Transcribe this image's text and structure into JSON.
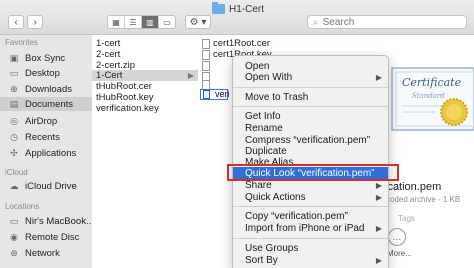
{
  "window": {
    "title": "H1-Cert"
  },
  "toolbar": {
    "back": "‹",
    "forward": "›",
    "view_modes": [
      "icons",
      "list",
      "columns",
      "gallery"
    ],
    "action_label": "⚙ ▾",
    "search_placeholder": "Search"
  },
  "sidebar": {
    "favorites_header": "Favorites",
    "favorites": [
      {
        "label": "Box Sync",
        "icon": "box-icon"
      },
      {
        "label": "Desktop",
        "icon": "desktop-icon"
      },
      {
        "label": "Downloads",
        "icon": "downloads-icon"
      },
      {
        "label": "Documents",
        "icon": "documents-icon"
      },
      {
        "label": "AirDrop",
        "icon": "airdrop-icon"
      },
      {
        "label": "Recents",
        "icon": "recents-icon"
      },
      {
        "label": "Applications",
        "icon": "applications-icon"
      }
    ],
    "icloud_header": "iCloud",
    "icloud": [
      {
        "label": "iCloud Drive",
        "icon": "cloud-icon"
      }
    ],
    "locations_header": "Locations",
    "locations": [
      {
        "label": "Nir's MacBook...",
        "icon": "laptop-icon"
      },
      {
        "label": "Remote Disc",
        "icon": "disc-icon"
      },
      {
        "label": "Network",
        "icon": "network-icon"
      }
    ]
  },
  "column1": {
    "items": [
      "1-cert",
      "2-cert",
      "2-cert.zip",
      "1-Cert",
      "tHubRoot.cer",
      "tHubRoot.key",
      "verification.key"
    ]
  },
  "column2": {
    "items": [
      "cert1Root.cer",
      "cert1Root.key",
      "",
      "",
      "",
      "verific"
    ]
  },
  "rename_field": {
    "value": "veri"
  },
  "context_menu": {
    "items": [
      {
        "label": "Open",
        "submenu": false
      },
      {
        "label": "Open With",
        "submenu": true
      },
      {
        "label": "Move to Trash",
        "submenu": false
      },
      {
        "label": "Get Info",
        "submenu": false
      },
      {
        "label": "Rename",
        "submenu": false
      },
      {
        "label": "Compress “verification.pem”",
        "submenu": false
      },
      {
        "label": "Duplicate",
        "submenu": false
      },
      {
        "label": "Make Alias",
        "submenu": false
      },
      {
        "label": "Quick Look “verification.pem”",
        "submenu": false
      },
      {
        "label": "Share",
        "submenu": true
      },
      {
        "label": "Quick Actions",
        "submenu": true
      },
      {
        "label": "Copy “verification.pem”",
        "submenu": false
      },
      {
        "label": "Import from iPhone or iPad",
        "submenu": true
      },
      {
        "label": "Use Groups",
        "submenu": false
      },
      {
        "label": "Sort By",
        "submenu": true
      }
    ],
    "highlighted_index": 8
  },
  "preview": {
    "certificate_text": "Certificate",
    "certificate_sub": "Standard",
    "file_name": "ication.pem",
    "kind": "coded archive - 1 KB",
    "tags": "Tags",
    "more_label": "More..."
  },
  "colors": {
    "highlight": "#2d6fd6",
    "callout": "#d42f2f",
    "folder": "#6aaee8"
  }
}
